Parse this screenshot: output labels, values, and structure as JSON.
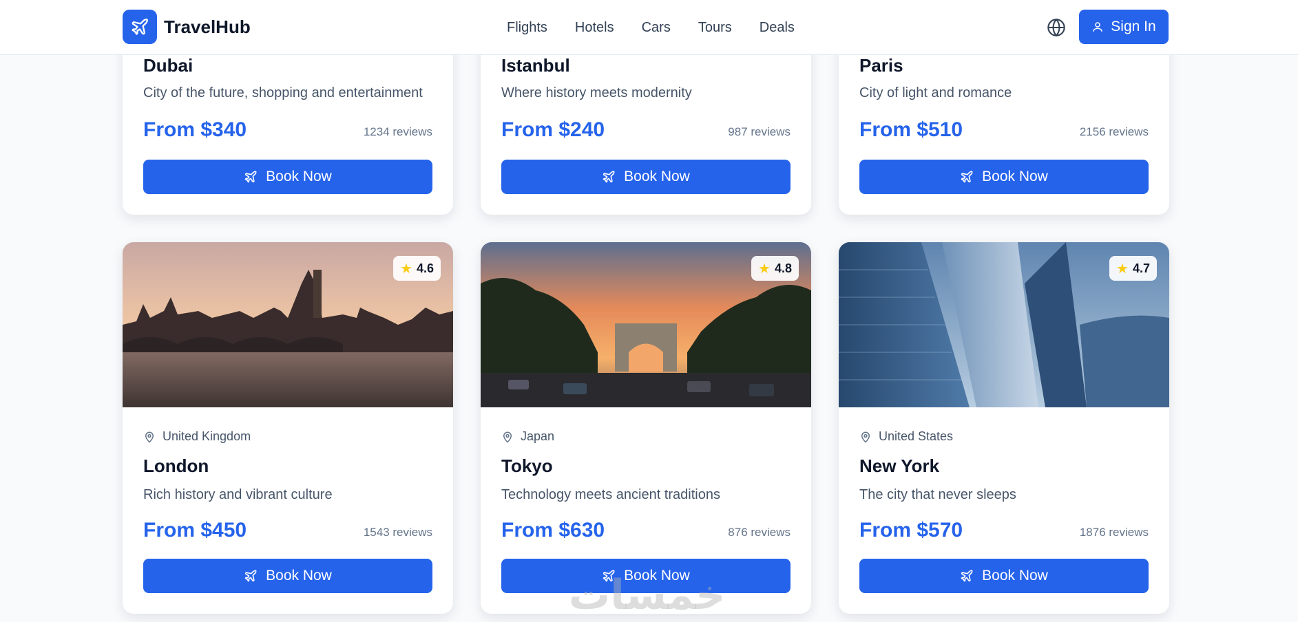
{
  "header": {
    "brand": "TravelHub",
    "nav": [
      "Flights",
      "Hotels",
      "Cars",
      "Tours",
      "Deals"
    ],
    "sign_in": "Sign In"
  },
  "cards": [
    {
      "city": "Dubai",
      "desc": "City of the future, shopping and entertainment",
      "price": "From $340",
      "reviews": "1234 reviews",
      "book": "Book Now"
    },
    {
      "city": "Istanbul",
      "desc": "Where history meets modernity",
      "price": "From $240",
      "reviews": "987 reviews",
      "book": "Book Now"
    },
    {
      "city": "Paris",
      "desc": "City of light and romance",
      "price": "From $510",
      "reviews": "2156 reviews",
      "book": "Book Now"
    },
    {
      "country": "United Kingdom",
      "city": "London",
      "desc": "Rich history and vibrant culture",
      "price": "From $450",
      "reviews": "1543 reviews",
      "rating": "4.6",
      "book": "Book Now"
    },
    {
      "country": "Japan",
      "city": "Tokyo",
      "desc": "Technology meets ancient traditions",
      "price": "From $630",
      "reviews": "876 reviews",
      "rating": "4.8",
      "book": "Book Now"
    },
    {
      "country": "United States",
      "city": "New York",
      "desc": "The city that never sleeps",
      "price": "From $570",
      "reviews": "1876 reviews",
      "rating": "4.7",
      "book": "Book Now"
    }
  ],
  "watermark": "خمسات",
  "colors": {
    "accent": "#2563eb",
    "star": "#facc15"
  }
}
